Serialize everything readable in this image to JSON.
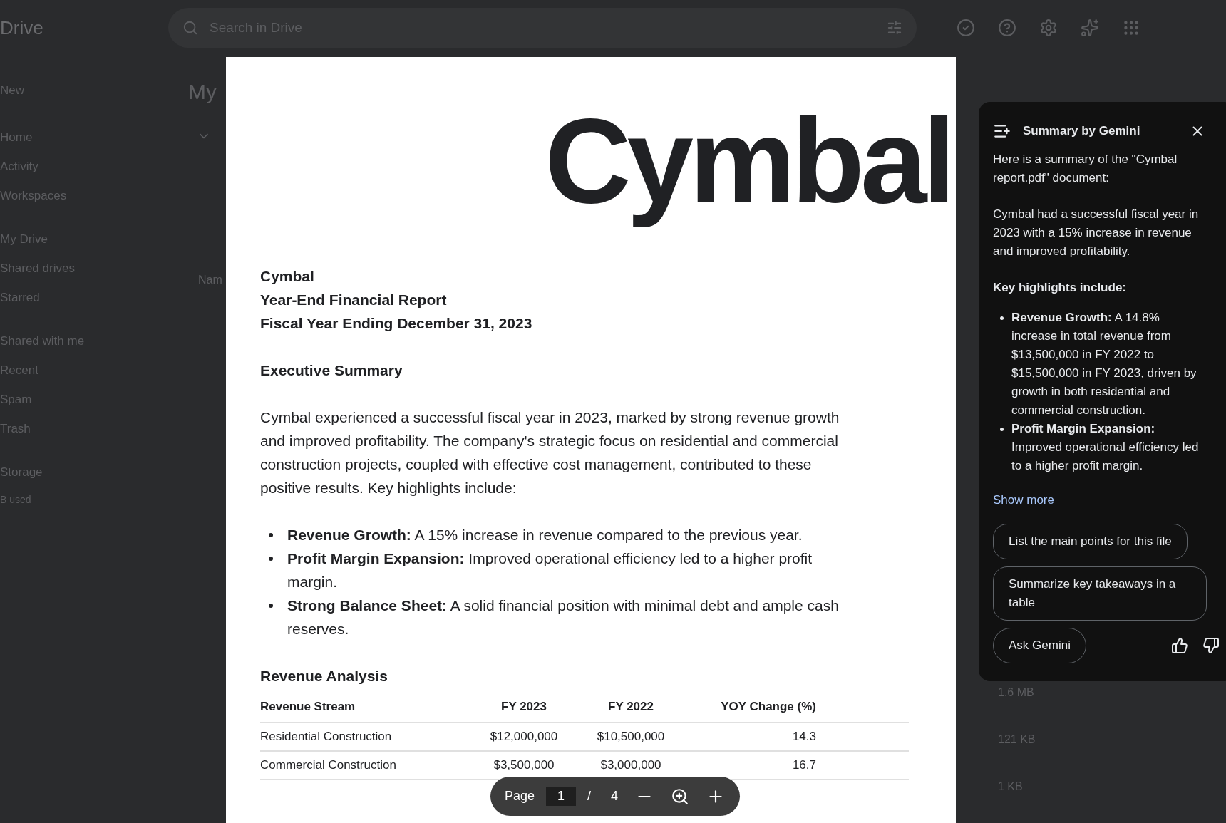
{
  "drive": {
    "app_name": "Drive",
    "search": {
      "placeholder": "Search in Drive"
    },
    "new_button": "New",
    "nav": [
      {
        "label": "Home"
      },
      {
        "label": "Activity"
      },
      {
        "label": "Workspaces"
      },
      {
        "label": "My Drive"
      },
      {
        "label": "Shared drives"
      },
      {
        "label": "Starred"
      },
      {
        "label": "Shared with me"
      },
      {
        "label": "Recent"
      },
      {
        "label": "Spam"
      },
      {
        "label": "Trash"
      },
      {
        "label": "Storage"
      }
    ],
    "storage_text": "B used",
    "page_title": "My",
    "column_header": "Nam",
    "file_sizes": [
      "1.6 MB",
      "121 KB",
      "1 KB"
    ]
  },
  "document": {
    "logo": "Cymbal",
    "title_lines": [
      "Cymbal",
      "Year-End Financial Report",
      "Fiscal Year Ending December 31, 2023"
    ],
    "section_1": "Executive Summary",
    "paragraph": "Cymbal experienced a successful fiscal year in 2023, marked by strong revenue growth and improved profitability. The company's strategic focus on residential and commercial construction projects, coupled with effective cost management, contributed to these positive results. Key highlights include:",
    "bullets": [
      "**Revenue Growth:** A 15% increase in revenue compared to the previous year.",
      "**Profit Margin Expansion:** Improved operational efficiency led to a higher profit margin.",
      "**Strong Balance Sheet:** A solid financial position with minimal debt and ample cash reserves."
    ],
    "section_2": "Revenue Analysis",
    "table": {
      "columns": [
        "Revenue Stream",
        "FY 2023",
        "FY 2022",
        "YOY Change (%)"
      ],
      "rows": [
        [
          "Residential Construction",
          "$12,000,000",
          "$10,500,000",
          "14.3"
        ],
        [
          "Commercial Construction",
          "$3,500,000",
          "$3,000,000",
          "16.7"
        ]
      ]
    }
  },
  "pager": {
    "label": "Page",
    "current": "1",
    "separator": "/",
    "total": "4"
  },
  "gemini": {
    "title": "Summary by Gemini",
    "intro": "Here is a summary of the \"Cymbal report.pdf\" document:",
    "summary": "Cymbal had a successful fiscal year in 2023 with a 15% increase in revenue and improved profitability.",
    "highlights_heading": "Key highlights include:",
    "bullets": [
      "**Revenue Growth:** A 14.8% increase in total revenue from $13,500,000 in FY 2022 to $15,500,000 in FY 2023, driven by growth in both residential and commercial construction.",
      "**Profit Margin Expansion:** Improved operational efficiency led to a higher profit margin."
    ],
    "show_more": "Show more",
    "suggestions": [
      "List the main points for this file",
      "Summarize key takeaways in a table"
    ],
    "ask_button": "Ask Gemini"
  }
}
